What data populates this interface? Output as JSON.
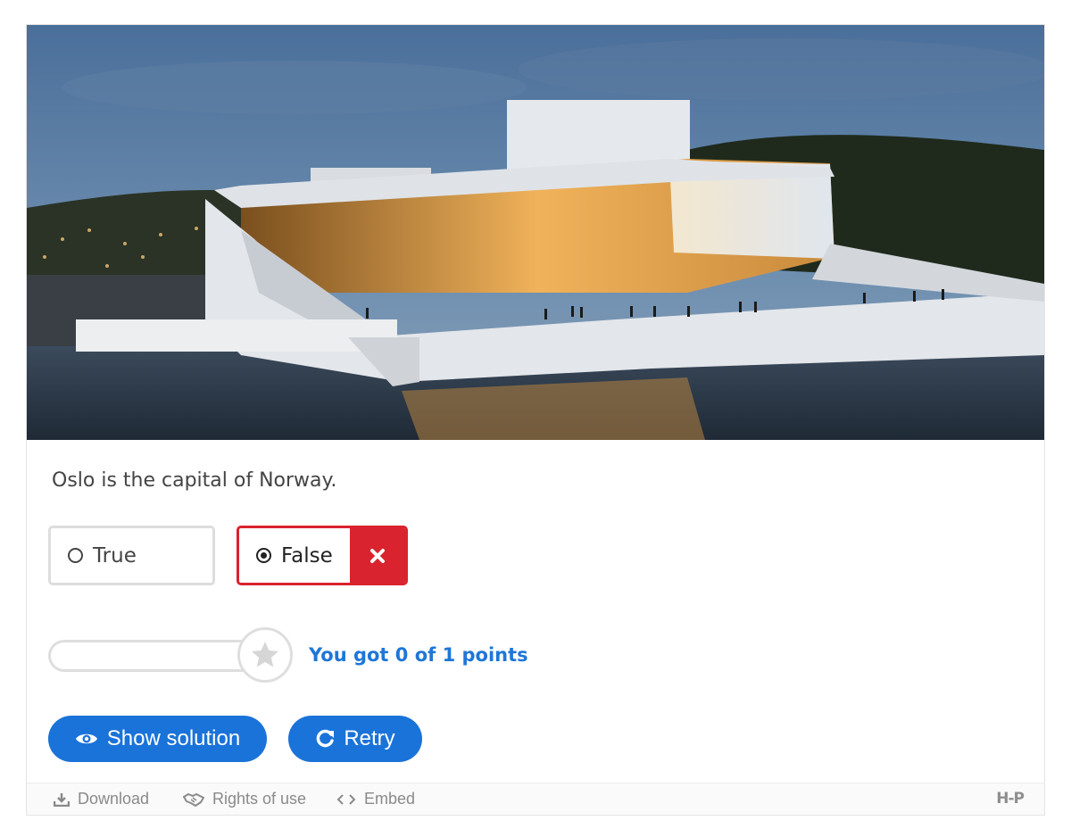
{
  "question": {
    "text": "Oslo is the capital of Norway."
  },
  "photo": {
    "alt": "Oslo Opera House at dusk"
  },
  "answers": {
    "true_label": "True",
    "false_label": "False",
    "selected": "False",
    "selected_state": "incorrect"
  },
  "score": {
    "text": "You got 0 of 1 points",
    "points": 0,
    "max_points": 1,
    "fraction": 0
  },
  "buttons": {
    "show_solution": "Show solution",
    "retry": "Retry"
  },
  "footer": {
    "download": "Download",
    "rights": "Rights of use",
    "embed": "Embed",
    "logo": "H-P"
  },
  "colors": {
    "accent": "#1a73d9",
    "score_text": "#1f76d7",
    "wrong": "#d9232e",
    "border": "#dddddd"
  }
}
